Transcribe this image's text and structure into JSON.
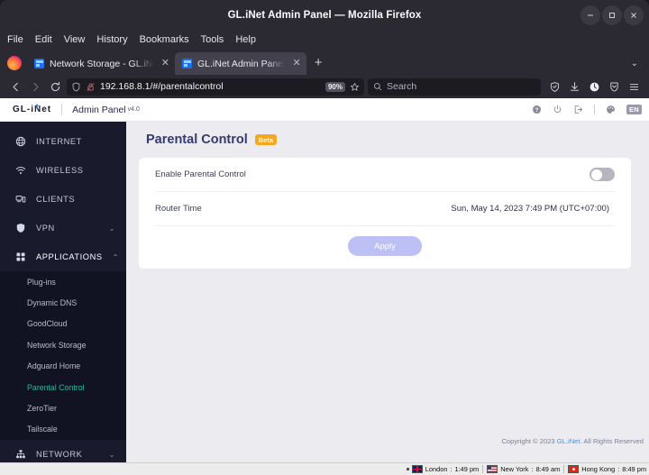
{
  "window": {
    "title": "GL.iNet Admin Panel — Mozilla Firefox",
    "minimize": "–",
    "maximize": "❐",
    "close": "✕"
  },
  "menubar": [
    "File",
    "Edit",
    "View",
    "History",
    "Bookmarks",
    "Tools",
    "Help"
  ],
  "tabs": [
    {
      "title": "Network Storage - GL.iNe",
      "close": "✕",
      "active": false
    },
    {
      "title": "GL.iNet Admin Panel",
      "close": "✕",
      "active": true
    }
  ],
  "tabstrip": {
    "new_tab": "+",
    "list_all_tabs": "⌄"
  },
  "navbar": {
    "back": "←",
    "forward": "→",
    "reload": "⟳",
    "url": "192.168.8.1/#/parentalcontrol",
    "zoom_level": "90%",
    "bookmark": "☆",
    "search_placeholder": "Search"
  },
  "admin_header": {
    "brand": "GL-iNet",
    "subtitle": "Admin Panel",
    "version": "v4.0",
    "icons": [
      "help-icon",
      "power-icon",
      "logout-icon",
      "theme-icon"
    ],
    "language": "EN"
  },
  "sidebar": {
    "items": [
      {
        "label": "INTERNET",
        "icon": "globe-icon",
        "chevron": ""
      },
      {
        "label": "WIRELESS",
        "icon": "wifi-icon",
        "chevron": ""
      },
      {
        "label": "CLIENTS",
        "icon": "clients-icon",
        "chevron": ""
      },
      {
        "label": "VPN",
        "icon": "shield-icon",
        "chevron": "⌄"
      },
      {
        "label": "APPLICATIONS",
        "icon": "grid-icon",
        "chevron": "⌃"
      }
    ],
    "applications_sub": [
      {
        "label": "Plug-ins",
        "active": false
      },
      {
        "label": "Dynamic DNS",
        "active": false
      },
      {
        "label": "GoodCloud",
        "active": false
      },
      {
        "label": "Network Storage",
        "active": false
      },
      {
        "label": "Adguard Home",
        "active": false
      },
      {
        "label": "Parental Control",
        "active": true
      },
      {
        "label": "ZeroTier",
        "active": false
      },
      {
        "label": "Tailscale",
        "active": false
      }
    ],
    "network": {
      "label": "NETWORK",
      "icon": "network-icon",
      "chevron": "⌄"
    }
  },
  "main": {
    "title": "Parental Control",
    "badge": "Beta",
    "rows": [
      {
        "label": "Enable Parental Control",
        "type": "toggle",
        "value": "off"
      },
      {
        "label": "Router Time",
        "type": "text",
        "value": "Sun, May 14, 2023 7:49 PM (UTC+07:00)"
      }
    ],
    "apply_label": "Apply"
  },
  "footer": {
    "copyright_prefix": "Copyright © 2023 ",
    "copyright_link": "GL.iNet",
    "copyright_suffix": ". All Rights Reserved",
    "clocks": [
      {
        "city": "London",
        "time": "1:49 pm",
        "flag": "uk"
      },
      {
        "city": "New York",
        "time": "8:49 am",
        "flag": "us"
      },
      {
        "city": "Hong Kong",
        "time": "8:49 pm",
        "flag": "hk"
      }
    ]
  },
  "colors": {
    "accent_teal": "#22b8a0",
    "title_indigo": "#353b6e",
    "beta_orange": "#f5a623",
    "apply_lavender": "#bdc0f5",
    "sidebar_bg": "#191a2b"
  }
}
